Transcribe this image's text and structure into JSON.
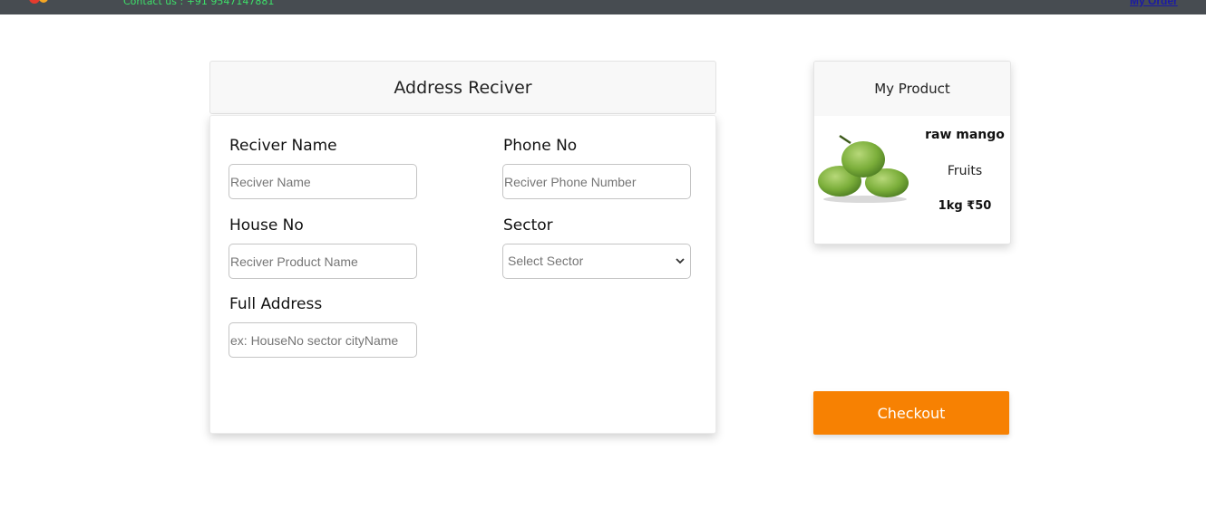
{
  "navbar": {
    "contact_text": "Contact us : +91 9547147881",
    "my_order_label": "My Order"
  },
  "address_form": {
    "title": "Address Reciver",
    "receiver_name": {
      "label": "Reciver Name",
      "placeholder": "Reciver Name"
    },
    "phone_no": {
      "label": "Phone No",
      "placeholder": "Reciver Phone Number"
    },
    "house_no": {
      "label": "House No",
      "placeholder": "Reciver Product Name"
    },
    "sector": {
      "label": "Sector",
      "selected": "Select Sector"
    },
    "full_address": {
      "label": "Full Address",
      "placeholder": "ex: HouseNo sector cityName"
    }
  },
  "product_card": {
    "title": "My Product",
    "name": "raw mango",
    "category": "Fruits",
    "price": "1kg ₹50"
  },
  "checkout_label": "Checkout",
  "colors": {
    "navbar_bg": "#474c51",
    "contact_text": "#3ee06a",
    "checkout_bg": "#f78102"
  }
}
